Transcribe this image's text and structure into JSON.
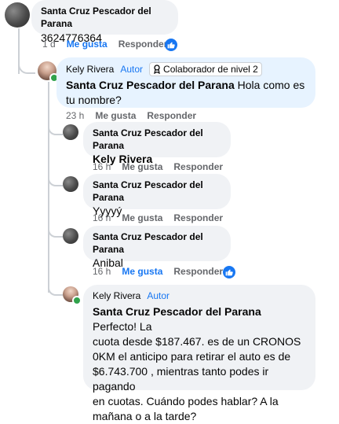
{
  "comments": [
    {
      "author": "Santa Cruz Pescador del Parana",
      "text": "3624776364",
      "time": "1 d",
      "like": "Me gusta",
      "reply": "Responder"
    },
    {
      "author": "Kely Rivera",
      "author_tag": "Autor",
      "badge": "Colaborador de nivel 2",
      "mention": "Santa Cruz Pescador del Parana",
      "text": " Hola como es tu nombre?",
      "time": "23 h",
      "like": "Me gusta",
      "reply": "Responder"
    },
    {
      "author": "Santa Cruz Pescador del Parana",
      "text": "Kely Rivera",
      "time": "16 h",
      "like": "Me gusta",
      "reply": "Responder"
    },
    {
      "author": "Santa Cruz Pescador del Parana",
      "text": "Yyyyý",
      "time": "16 h",
      "like": "Me gusta",
      "reply": "Responder"
    },
    {
      "author": "Santa Cruz Pescador del Parana",
      "text": "Anibal",
      "time": "16 h",
      "like": "Me gusta",
      "reply": "Responder"
    },
    {
      "author": "Kely Rivera",
      "author_tag": "Autor",
      "mention": "Santa Cruz Pescador del Parana",
      "text_lines": [
        " Perfecto! La",
        "cuota desde $187.467. es de un CRONOS",
        "0KM el anticipo para retirar el auto es de",
        "$6.743.700 , mientras tanto podes ir pagando",
        "en cuotas. Cuándo podes hablar? A la",
        "mañana o a la tarde?"
      ]
    }
  ],
  "colors": {
    "bubble": "#f0f2f5",
    "bubble_highlight": "#e7f3ff",
    "accent": "#1877f2",
    "online": "#31a24c"
  },
  "icons": {
    "like_reaction": "thumbs-up-icon",
    "badge": "contributor-badge-icon"
  }
}
